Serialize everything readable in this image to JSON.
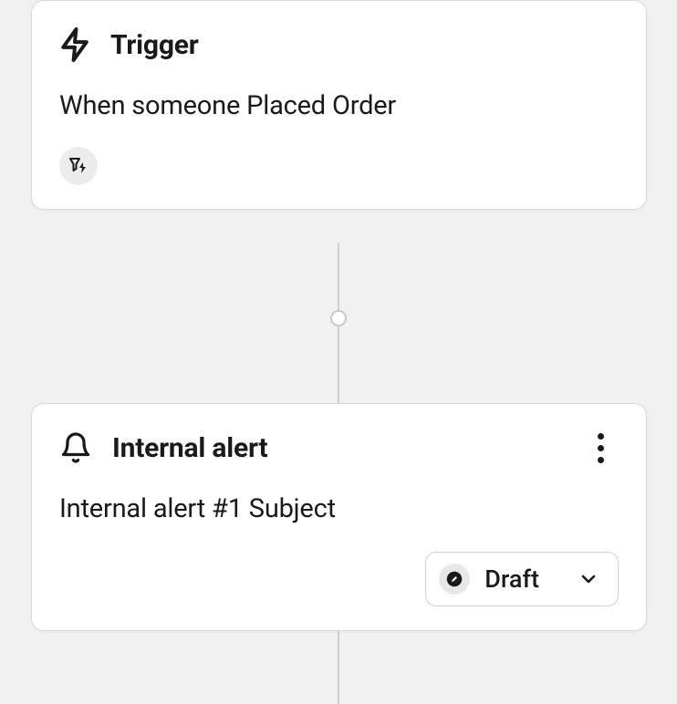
{
  "trigger": {
    "title": "Trigger",
    "description": "When someone Placed Order"
  },
  "alert": {
    "title": "Internal alert",
    "description": "Internal alert #1 Subject",
    "status_label": "Draft"
  }
}
